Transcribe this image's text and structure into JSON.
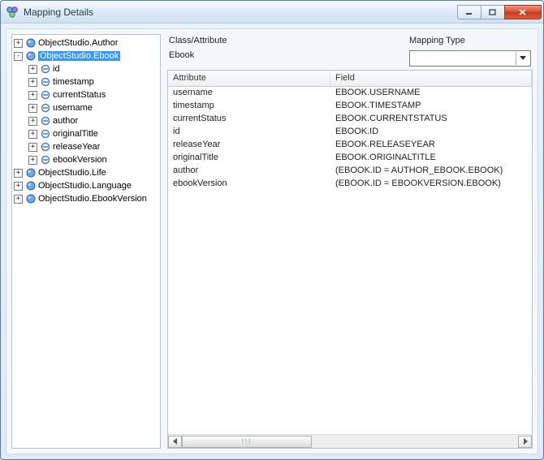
{
  "window": {
    "title": "Mapping Details"
  },
  "header": {
    "class_attr_label": "Class/Attribute",
    "class_attr_value": "Ebook",
    "mapping_type_label": "Mapping Type",
    "mapping_type_value": ""
  },
  "tree": [
    {
      "label": "ObjectStudio.Author",
      "icon": "class",
      "exp": "+"
    },
    {
      "label": "ObjectStudio.Ebook",
      "icon": "class",
      "exp": "-",
      "selected": true,
      "children": [
        {
          "label": "id",
          "icon": "attr",
          "exp": "+"
        },
        {
          "label": "timestamp",
          "icon": "attr",
          "exp": "+"
        },
        {
          "label": "currentStatus",
          "icon": "attr",
          "exp": "+"
        },
        {
          "label": "username",
          "icon": "attr",
          "exp": "+"
        },
        {
          "label": "author",
          "icon": "attr",
          "exp": "+"
        },
        {
          "label": "originalTitle",
          "icon": "attr",
          "exp": "+"
        },
        {
          "label": "releaseYear",
          "icon": "attr",
          "exp": "+"
        },
        {
          "label": "ebookVersion",
          "icon": "attr",
          "exp": "+"
        }
      ]
    },
    {
      "label": "ObjectStudio.Life",
      "icon": "class",
      "exp": "+"
    },
    {
      "label": "ObjectStudio.Language",
      "icon": "class",
      "exp": "+"
    },
    {
      "label": "ObjectStudio.EbookVersion",
      "icon": "class",
      "exp": "+"
    }
  ],
  "table": {
    "columns": {
      "attr": "Attribute",
      "field": "Field"
    },
    "rows": [
      {
        "attr": "username",
        "field": "EBOOK.USERNAME"
      },
      {
        "attr": "timestamp",
        "field": "EBOOK.TIMESTAMP"
      },
      {
        "attr": "currentStatus",
        "field": "EBOOK.CURRENTSTATUS"
      },
      {
        "attr": "id",
        "field": "EBOOK.ID"
      },
      {
        "attr": "releaseYear",
        "field": "EBOOK.RELEASEYEAR"
      },
      {
        "attr": "originalTitle",
        "field": "EBOOK.ORIGINALTITLE"
      },
      {
        "attr": "author",
        "field": "(EBOOK.ID = AUTHOR_EBOOK.EBOOK)"
      },
      {
        "attr": "ebookVersion",
        "field": "(EBOOK.ID = EBOOKVERSION.EBOOK)"
      }
    ]
  },
  "scroll_grip": "!!!"
}
